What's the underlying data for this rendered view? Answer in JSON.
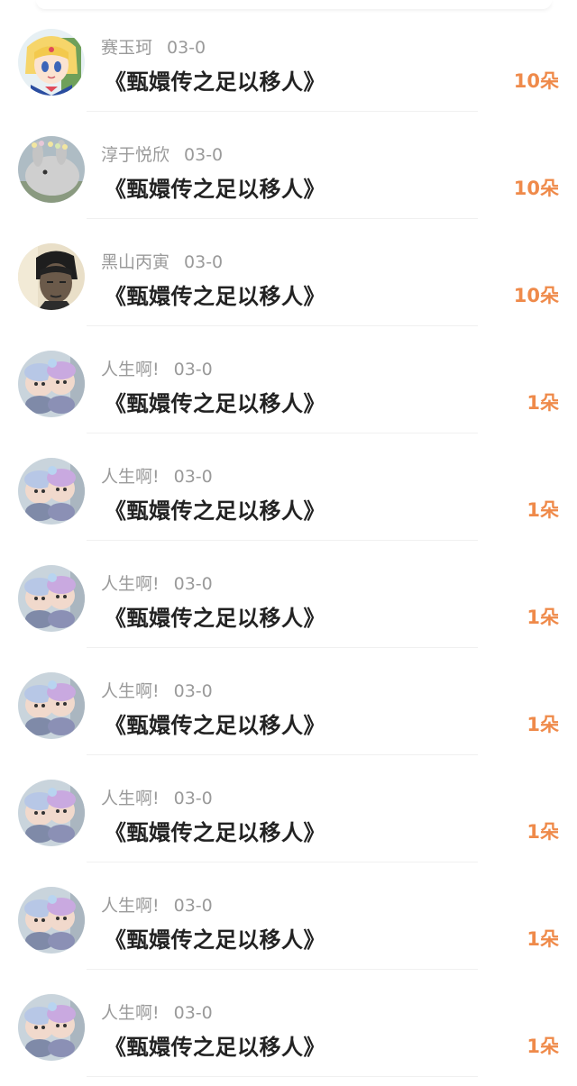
{
  "gift_list": {
    "items": [
      {
        "username": "赛玉珂",
        "date": "03-0",
        "title": "《甄嬛传之足以移人》",
        "gift_count": "10朵",
        "avatar": "sailor-moon-avatar"
      },
      {
        "username": "淳于悦欣",
        "date": "03-0",
        "title": "《甄嬛传之足以移人》",
        "gift_count": "10朵",
        "avatar": "rabbit-avatar"
      },
      {
        "username": "黑山丙寅",
        "date": "03-0",
        "title": "《甄嬛传之足以移人》",
        "gift_count": "10朵",
        "avatar": "man-portrait-avatar"
      },
      {
        "username": "人生啊!",
        "date": "03-0",
        "title": "《甄嬛传之足以移人》",
        "gift_count": "1朵",
        "avatar": "dolls-avatar"
      },
      {
        "username": "人生啊!",
        "date": "03-0",
        "title": "《甄嬛传之足以移人》",
        "gift_count": "1朵",
        "avatar": "dolls-avatar"
      },
      {
        "username": "人生啊!",
        "date": "03-0",
        "title": "《甄嬛传之足以移人》",
        "gift_count": "1朵",
        "avatar": "dolls-avatar"
      },
      {
        "username": "人生啊!",
        "date": "03-0",
        "title": "《甄嬛传之足以移人》",
        "gift_count": "1朵",
        "avatar": "dolls-avatar"
      },
      {
        "username": "人生啊!",
        "date": "03-0",
        "title": "《甄嬛传之足以移人》",
        "gift_count": "1朵",
        "avatar": "dolls-avatar"
      },
      {
        "username": "人生啊!",
        "date": "03-0",
        "title": "《甄嬛传之足以移人》",
        "gift_count": "1朵",
        "avatar": "dolls-avatar"
      },
      {
        "username": "人生啊!",
        "date": "03-0",
        "title": "《甄嬛传之足以移人》",
        "gift_count": "1朵",
        "avatar": "dolls-avatar"
      }
    ]
  },
  "colors": {
    "accent_orange": "#ef8a4a",
    "meta_gray": "#9a9a9a",
    "title_dark": "#222222"
  }
}
